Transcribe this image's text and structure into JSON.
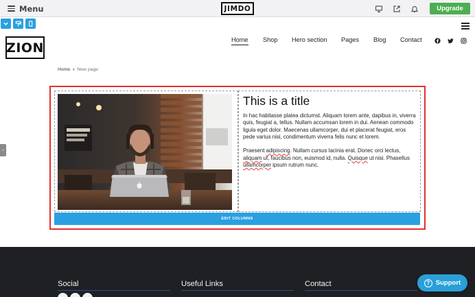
{
  "editor_bar": {
    "menu_label": "Menu",
    "brand": "JIMDO",
    "upgrade_label": "Upgrade",
    "icons": [
      "desktop-preview-icon",
      "share-icon",
      "bell-icon"
    ],
    "upgrade_color": "#4caf50"
  },
  "view_toggles": [
    "chevron-down-icon",
    "paint-roller-icon",
    "mobile-icon"
  ],
  "site": {
    "logo": "ZION",
    "nav": [
      {
        "label": "Home",
        "active": true
      },
      {
        "label": "Shop"
      },
      {
        "label": "Hero section"
      },
      {
        "label": "Pages"
      },
      {
        "label": "Blog"
      },
      {
        "label": "Contact"
      }
    ],
    "social_icons": [
      "facebook-icon",
      "twitter-icon",
      "instagram-icon"
    ]
  },
  "breadcrumb": {
    "home": "Home",
    "current": "New page"
  },
  "module": {
    "title": "This is a title",
    "paragraph1": "In hac habitasse platea dictumst. Aliquam lorem ante, dapibus in, viverra quis, feugiat a, tellus. Nullam accumsan lorem in dui. Aenean commodo ligula eget dolor. Maecenas ullamcorper, dui et placerat feugiat, eros pede varius nisi, condimentum viverra felis nunc et lorem.",
    "p2_a": "Praesent ",
    "p2_b": "adipiscing",
    "p2_c": ". Nullam cursus lacinia erat. Donec orci lectus, ",
    "p2_d": "aliquam",
    "p2_e": " ut, faucibus non, euismod id, nulla. ",
    "p2_f": "Quisque",
    "p2_g": " ut nisi. Phasellus ",
    "p2_h": "ullamcorper",
    "p2_i": " ipsum rutrum nunc.",
    "edit_label": "EDIT COLUMNS",
    "frame_color": "#e03131",
    "accent_color": "#2aa0e0"
  },
  "footer": {
    "columns": [
      "Social",
      "Useful Links",
      "Contact"
    ],
    "support_label": "Support",
    "background": "#1f2024"
  }
}
